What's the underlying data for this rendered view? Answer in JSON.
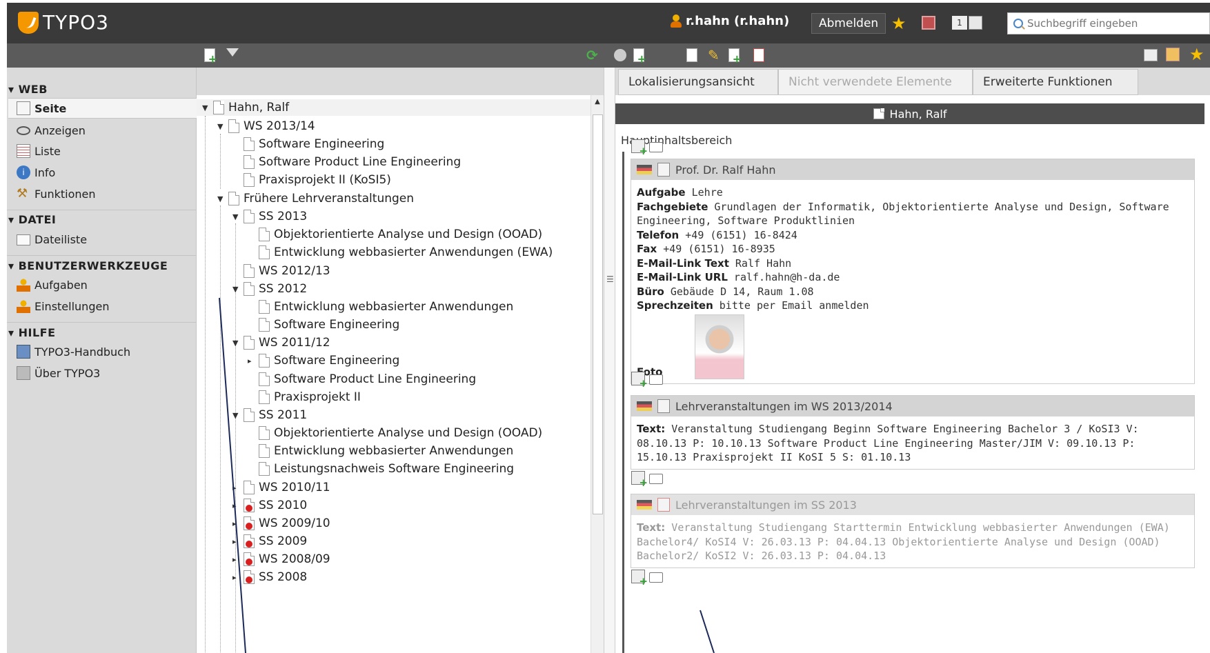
{
  "topbar": {
    "logo": "TYPO3",
    "user": "r.hahn (r.hahn)",
    "logout_label": "Abmelden",
    "badge_count": "1",
    "search_placeholder": "Suchbegriff eingeben"
  },
  "modules": {
    "web_heading": "WEB",
    "web_items": [
      "Seite",
      "Anzeigen",
      "Liste",
      "Info",
      "Funktionen"
    ],
    "datei_heading": "DATEI",
    "datei_items": [
      "Dateiliste"
    ],
    "tools_heading": "BENUTZERWERKZEUGE",
    "tools_items": [
      "Aufgaben",
      "Einstellungen"
    ],
    "help_heading": "HILFE",
    "help_items": [
      "TYPO3-Handbuch",
      "Über TYPO3"
    ]
  },
  "tree": {
    "root": "Hahn, Ralf",
    "nodes": [
      "WS 2013/14",
      "Software Engineering",
      "Software Product Line Engineering",
      "Praxisprojekt II (KoSI5)",
      "Frühere Lehrveranstaltungen",
      "SS 2013",
      "Objektorientierte Analyse und Design (OOAD)",
      "Entwicklung webbasierter Anwendungen (EWA)",
      "WS 2012/13",
      "SS 2012",
      "Entwicklung webbasierter Anwendungen",
      "Software Engineering",
      "WS 2011/12",
      "Software Engineering",
      "Software Product Line Engineering",
      "Praxisprojekt II",
      "SS 2011",
      "Objektorientierte Analyse und Design (OOAD)",
      "Entwicklung webbasierter Anwendungen",
      "Leistungsnachweis Software Engineering",
      "WS 2010/11",
      "SS 2010",
      "WS 2009/10",
      "SS 2009",
      "WS 2008/09",
      "SS 2008"
    ]
  },
  "content": {
    "tabs": [
      "Lokalisierungsansicht",
      "Nicht verwendete Elemente",
      "Erweiterte Funktionen"
    ],
    "page_title": "Hahn, Ralf",
    "area_label": "Hauptinhaltsbereich",
    "ce1": {
      "title": "Prof. Dr. Ralf Hahn",
      "aufgabe_label": "Aufgabe",
      "aufgabe": " Lehre",
      "fach_label": "Fachgebiete",
      "fach": " Grundlagen der Informatik, Objektorientierte Analyse und Design, Software Engineering, Software Produktlinien",
      "tel_label": "Telefon",
      "tel": " +49 (6151) 16-8424",
      "fax_label": "Fax",
      "fax": " +49 (6151) 16-8935",
      "mailtext_label": "E-Mail-Link Text",
      "mailtext": " Ralf Hahn",
      "mailurl_label": "E-Mail-Link URL",
      "mailurl": " ralf.hahn@h-da.de",
      "buero_label": "Büro",
      "buero": " Gebäude D 14, Raum 1.08",
      "sprech_label": "Sprechzeiten",
      "sprech": " bitte per Email anmelden",
      "foto_label": "Foto"
    },
    "ce2": {
      "title": "Lehrveranstaltungen im WS 2013/2014",
      "text_label": "Text:",
      "text": " Veranstaltung Studiengang Beginn Software Engineering Bachelor 3 / KoSI3 V: 08.10.13 P: 10.10.13 Software Product Line Engineering Master/JIM V: 09.10.13 P: 15.10.13 Praxisprojekt II KoSI 5 S: 01.10.13"
    },
    "ce3": {
      "title": "Lehrveranstaltungen im SS 2013",
      "text_label": "Text:",
      "text": " Veranstaltung Studiengang Starttermin Entwicklung webbasierter Anwendungen (EWA) Bachelor4/ KoSI4 V: 26.03.13 P: 04.04.13 Objektorientierte Analyse und Design (OOAD) Bachelor2/ KoSI2 V: 26.03.13 P: 04.04.13"
    }
  },
  "colors": {
    "topbar": "#3a3a3a",
    "toolbar": "#5b5b5b",
    "sidebar": "#dadada",
    "accent": "#f49700",
    "annotation_line": "#1c2a5a"
  }
}
